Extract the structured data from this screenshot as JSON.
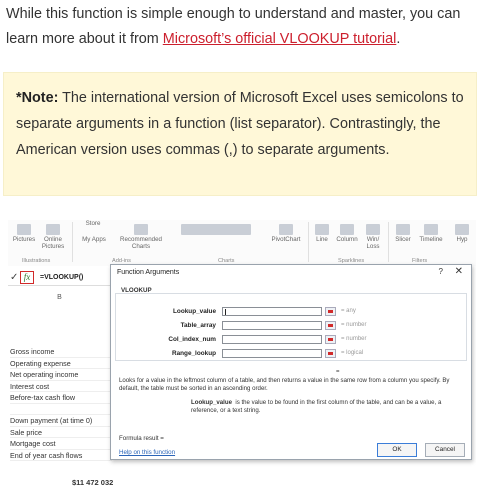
{
  "intro": {
    "text_before": "While this function is simple enough to understand and master, you can learn more about it from ",
    "link_text": "Microsoft’s official VLOOKUP tutorial",
    "text_after": "."
  },
  "note": {
    "label": "*Note:",
    "text": " The international version of Microsoft Excel uses semicolons to separate arguments in a function (list separator). Contrastingly, the American version uses commas (,) to separate arguments."
  },
  "excel": {
    "ribbon": {
      "items": [
        {
          "label": "Pictures",
          "icon": "picture-icon"
        },
        {
          "label": "Online Pictures",
          "icon": "online-picture-icon"
        },
        {
          "label": "Store",
          "icon": "store-icon"
        },
        {
          "label": "My Apps",
          "icon": "apps-icon"
        },
        {
          "label": "Recommended Charts",
          "icon": "chart-icon"
        },
        {
          "label": "PivotChart",
          "icon": "pivotchart-icon"
        },
        {
          "label": "Line",
          "icon": "line-icon"
        },
        {
          "label": "Column",
          "icon": "column-icon"
        },
        {
          "label": "Win/ Loss",
          "icon": "winloss-icon"
        },
        {
          "label": "Slicer",
          "icon": "slicer-icon"
        },
        {
          "label": "Timeline",
          "icon": "timeline-icon"
        },
        {
          "label": "Hyp",
          "icon": "hyperlink-icon"
        }
      ],
      "groups": [
        "Illustrations",
        "Add-ins",
        "Charts",
        "Sparklines",
        "Filters"
      ]
    },
    "formula_bar": {
      "fx_label": "fx",
      "content": "=VLOOKUP()"
    },
    "column_header": "B",
    "rows": [
      "Gross income",
      "Operating expense",
      "Net operating income",
      "Interest cost",
      "Before-tax cash flow",
      "",
      "Down payment (at time 0)",
      "Sale price",
      "Mortgage cost",
      "End of year cash flows"
    ],
    "bottom_value": "$11 472 032",
    "dialog": {
      "title": "Function Arguments",
      "help": "?",
      "close": "✕",
      "function_name": "VLOOKUP",
      "args": [
        {
          "label": "Lookup_value",
          "hint": "= any"
        },
        {
          "label": "Table_array",
          "hint": "= number"
        },
        {
          "label": "Col_index_num",
          "hint": "= number"
        },
        {
          "label": "Range_lookup",
          "hint": "= logical"
        }
      ],
      "equals": "=",
      "description": "Looks for a value in the leftmost column of a table, and then returns a value in the same row from a column you specify. By default, the table must be sorted in an ascending order.",
      "arg_desc_label": "Lookup_value",
      "arg_desc_text": "is the value to be found in the first column of the table, and can be a value, a reference, or a text string.",
      "formula_result": "Formula result =",
      "help_link": "Help on this function",
      "ok_label": "OK",
      "cancel_label": "Cancel"
    }
  }
}
